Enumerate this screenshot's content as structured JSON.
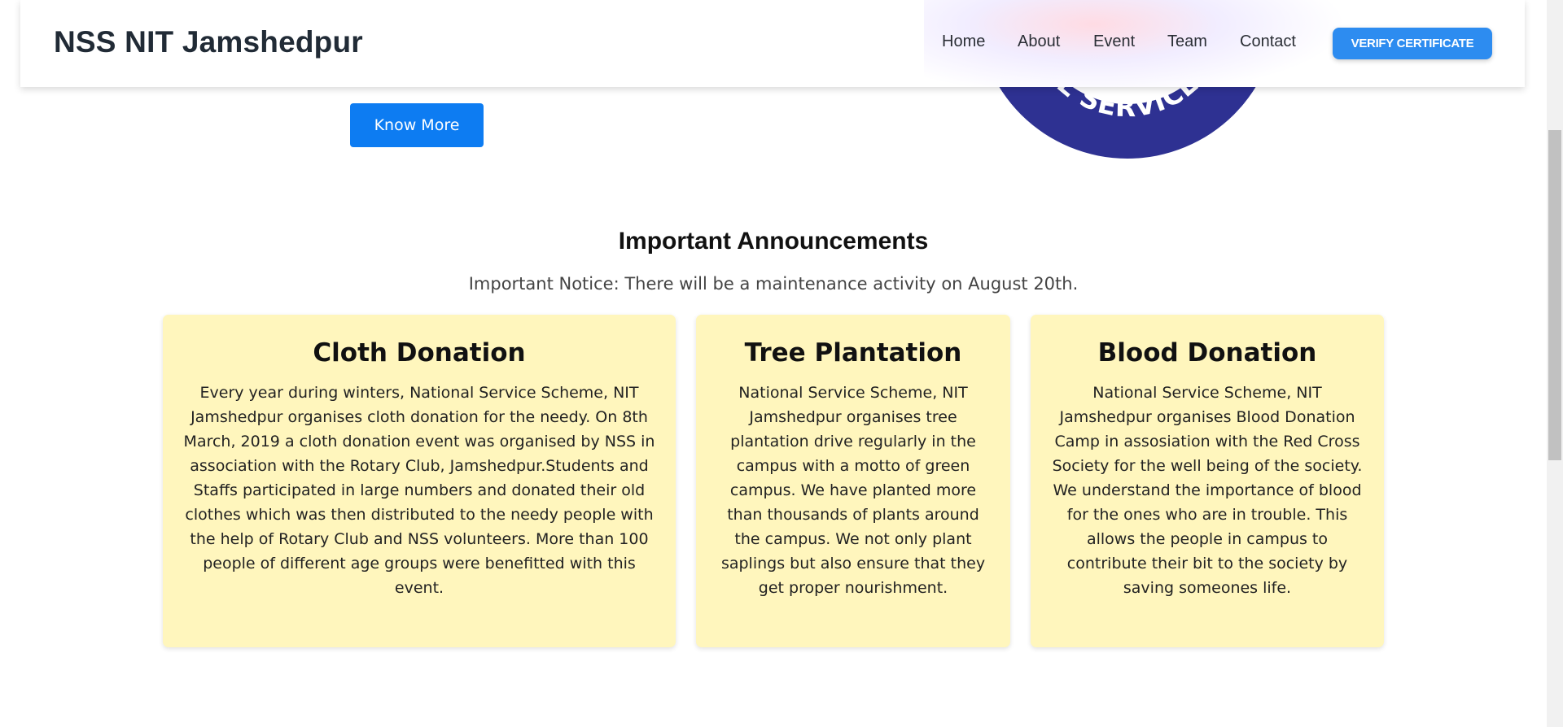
{
  "header": {
    "brand": "NSS NIT Jamshedpur",
    "nav": [
      "Home",
      "About",
      "Event",
      "Team",
      "Contact"
    ],
    "verify_label": "VERIFY CERTIFICATE"
  },
  "hero": {
    "know_more_label": "Know More",
    "logo_text": "NATIONAL SERVICE SCHEME"
  },
  "announcements": {
    "title": "Important Announcements",
    "notice": "Important Notice: There will be a maintenance activity on August 20th."
  },
  "cards": [
    {
      "title": "Cloth Donation",
      "text": "Every year during winters, National Service Scheme, NIT Jamshedpur organises cloth donation for the needy. On 8th March, 2019 a cloth donation event was organised by NSS in association with the Rotary Club, Jamshedpur.Students and Staffs participated in large numbers and donated their old clothes which was then distributed to the needy people with the help of Rotary Club and NSS volunteers. More than 100 people of different age groups were benefitted with this event."
    },
    {
      "title": "Tree Plantation",
      "text": "National Service Scheme, NIT Jamshedpur organises tree plantation drive regularly in the campus with a motto of green campus. We have planted more than thousands of plants around the campus. We not only plant saplings but also ensure that they get proper nourishment."
    },
    {
      "title": "Blood Donation",
      "text": "National Service Scheme, NIT Jamshedpur organises Blood Donation Camp in assosiation with the Red Cross Society for the well being of the society. We understand the importance of blood for the ones who are in trouble. This allows the people in campus to contribute their bit to the society by saving someones life."
    }
  ],
  "colors": {
    "card_bg": "#fff6bd",
    "button_blue": "#0d7cf2",
    "verify_blue": "#2d8cf0",
    "logo_navy": "#2e3192"
  }
}
